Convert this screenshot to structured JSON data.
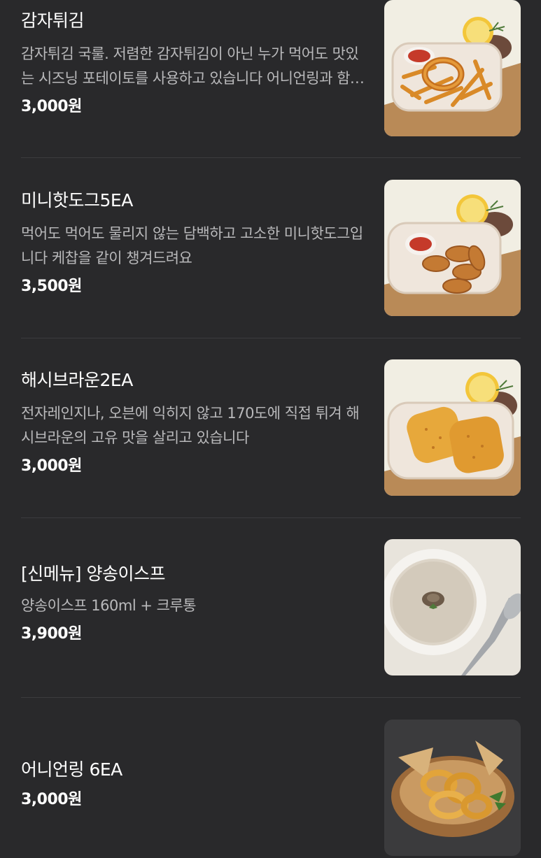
{
  "menu": {
    "items": [
      {
        "name": "감자튀김",
        "description": "감자튀김 국룰. 저렴한 감자튀김이 아닌 누가 먹어도 맛있는 시즈닝 포테이토를 사용하고 있습니다 어니언링과 함께 즐겨보세요",
        "price": "3,000원",
        "image": "fries-photo"
      },
      {
        "name": "미니핫도그5EA",
        "description": "먹어도 먹어도 물리지 않는 담백하고 고소한 미니핫도그입니다 케찹을 같이 챙겨드려요",
        "price": "3,500원",
        "image": "mini-hotdog-photo"
      },
      {
        "name": "해시브라운2EA",
        "description": "전자레인지나, 오븐에 익히지 않고 170도에 직접 튀겨 해시브라운의 고유 맛을 살리고 있습니다",
        "price": "3,000원",
        "image": "hash-brown-photo"
      },
      {
        "name": "[신메뉴] 양송이스프",
        "description": "양송이스프 160ml + 크루통",
        "price": "3,900원",
        "image": "mushroom-soup-photo"
      },
      {
        "name": "어니언링 6EA",
        "description": "",
        "price": "3,000원",
        "image": "onion-ring-photo"
      }
    ]
  },
  "colors": {
    "background": "#29292b",
    "text_primary": "#ffffff",
    "text_secondary": "#b9b9bb",
    "divider": "#3b3b3e"
  }
}
